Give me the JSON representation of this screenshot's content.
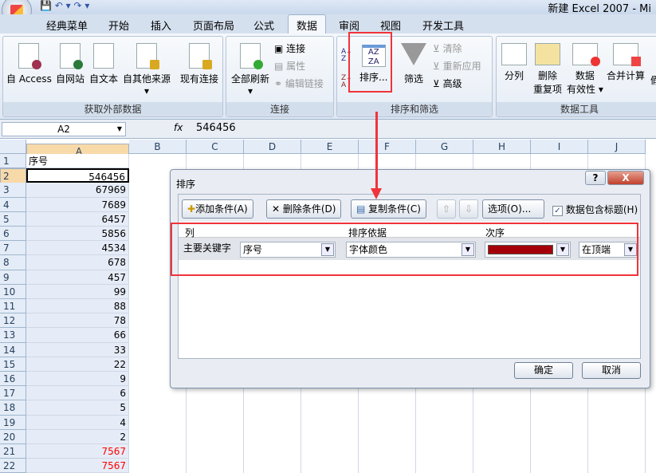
{
  "window": {
    "title": "新建 Excel 2007 - Mi"
  },
  "tabs": [
    "经典菜单",
    "开始",
    "插入",
    "页面布局",
    "公式",
    "数据",
    "审阅",
    "视图",
    "开发工具"
  ],
  "ribbon": {
    "get_external": {
      "label": "获取外部数据",
      "buttons": [
        "自 Access",
        "自网站",
        "自文本",
        "自其他来源",
        "现有连接"
      ]
    },
    "connections": {
      "label": "连接",
      "refresh": "全部刷新",
      "items": [
        "连接",
        "属性",
        "编辑链接"
      ]
    },
    "sort_filter": {
      "label": "排序和筛选",
      "sort": "排序...",
      "filter": "筛选",
      "items": [
        "清除",
        "重新应用",
        "高级"
      ]
    },
    "data_tools": {
      "label": "数据工具",
      "buttons": [
        "分列",
        "删除\n重复项",
        "数据\n有效性",
        "合并计算"
      ],
      "split": "分列",
      "dup1": "删除",
      "dup2": "重复项",
      "val1": "数据",
      "val2": "有效性",
      "consol": "合并计算",
      "extra": "假"
    }
  },
  "formula_bar": {
    "name_box": "A2",
    "fx": "fx",
    "value": "546456"
  },
  "columns": [
    "A",
    "B",
    "C",
    "D",
    "E",
    "F",
    "G",
    "H",
    "I",
    "J"
  ],
  "rows": [
    {
      "n": "1",
      "v": "序号"
    },
    {
      "n": "2",
      "v": "546456"
    },
    {
      "n": "3",
      "v": "67969"
    },
    {
      "n": "4",
      "v": "7689"
    },
    {
      "n": "5",
      "v": "6457"
    },
    {
      "n": "6",
      "v": "5856"
    },
    {
      "n": "7",
      "v": "4534"
    },
    {
      "n": "8",
      "v": "678"
    },
    {
      "n": "9",
      "v": "457"
    },
    {
      "n": "10",
      "v": "99"
    },
    {
      "n": "11",
      "v": "88"
    },
    {
      "n": "12",
      "v": "78"
    },
    {
      "n": "13",
      "v": "66"
    },
    {
      "n": "14",
      "v": "33"
    },
    {
      "n": "15",
      "v": "22"
    },
    {
      "n": "16",
      "v": "9"
    },
    {
      "n": "17",
      "v": "6"
    },
    {
      "n": "18",
      "v": "5"
    },
    {
      "n": "19",
      "v": "4"
    },
    {
      "n": "20",
      "v": "2"
    },
    {
      "n": "21",
      "v": "7567",
      "red": true
    },
    {
      "n": "22",
      "v": "7567",
      "red": true
    }
  ],
  "dialog": {
    "title": "排序",
    "help": "?",
    "close": "X",
    "add": "添加条件(A)",
    "delete": "删除条件(D)",
    "copy": "复制条件(C)",
    "up": "⇧",
    "down": "⇩",
    "options": "选项(O)...",
    "has_header": "数据包含标题(H)",
    "has_header_checked": true,
    "col_header": "列",
    "sort_on_header": "排序依据",
    "order_header": "次序",
    "key_label": "主要关键字",
    "column": "序号",
    "sort_on": "字体颜色",
    "color": "#a50009",
    "position": "在顶端",
    "ok": "确定",
    "cancel": "取消"
  },
  "colors": {
    "highlight": "#f0333a",
    "red_text": "#ff0000"
  }
}
